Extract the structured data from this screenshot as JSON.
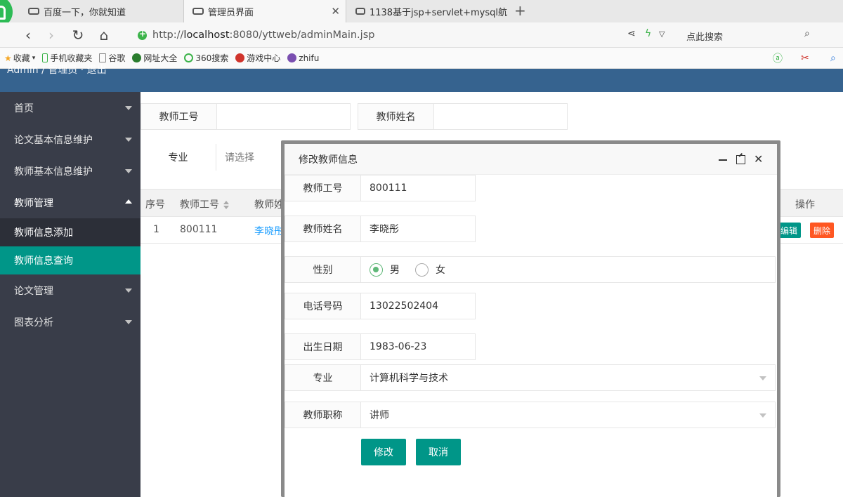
{
  "browser": {
    "tabs": [
      {
        "title": "百度一下，你就知道"
      },
      {
        "title": "管理员界面"
      },
      {
        "title": "1138基于jsp+servlet+mysql航"
      }
    ],
    "url_scheme": "http://",
    "url_host": "localhost",
    "url_rest": ":8080/yttweb/adminMain.jsp",
    "search_label": "点此搜索",
    "bookmarks": [
      "收藏",
      "手机收藏夹",
      "谷歌",
      "网址大全",
      "360搜索",
      "游戏中心",
      "zhifu"
    ]
  },
  "app": {
    "brand": "Admin / 管理员 · 退出"
  },
  "sidebar": {
    "items": [
      {
        "label": "首页"
      },
      {
        "label": "论文基本信息维护"
      },
      {
        "label": "教师基本信息维护"
      },
      {
        "label": "教师管理"
      },
      {
        "label": "论文管理"
      },
      {
        "label": "图表分析"
      }
    ],
    "subitems": [
      {
        "label": "教师信息添加"
      },
      {
        "label": "教师信息查询"
      }
    ]
  },
  "search_form": {
    "teacher_id_label": "教师工号",
    "teacher_name_label": "教师姓名",
    "major_label": "专业",
    "major_placeholder": "请选择"
  },
  "table": {
    "headers": [
      "序号",
      "教师工号",
      "教师姓",
      "操作"
    ],
    "rows": [
      {
        "index": "1",
        "teacher_id": "800111",
        "name": "李晓彤"
      }
    ],
    "edit_label": "编辑",
    "delete_label": "删除"
  },
  "modal": {
    "title": "修改教师信息",
    "teacher_id_label": "教师工号",
    "teacher_id": "800111",
    "teacher_name_label": "教师姓名",
    "teacher_name": "李晓彤",
    "gender_label": "性别",
    "gender_male": "男",
    "gender_female": "女",
    "phone_label": "电话号码",
    "phone": "13022502404",
    "birth_label": "出生日期",
    "birth": "1983-06-23",
    "major_label": "专业",
    "major": "计算机科学与技术",
    "title_label": "教师职称",
    "title_value": "讲师",
    "save_label": "修改",
    "cancel_label": "取消"
  },
  "colors": {
    "primary": "#009688",
    "header": "#36638f",
    "sidebar": "#393d49",
    "link": "#1e9fff",
    "danger": "#ff5722"
  }
}
